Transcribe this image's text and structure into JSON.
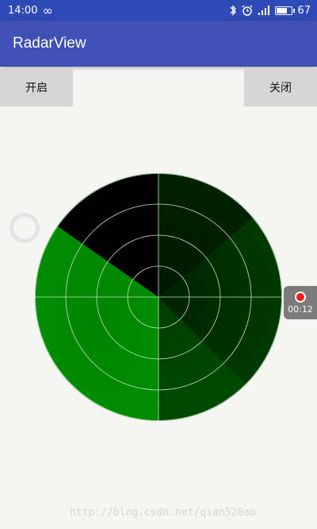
{
  "status_bar": {
    "time": "14:00",
    "infinity": "∞",
    "battery": "67",
    "battery_level": 0.67
  },
  "app_bar": {
    "title": "RadarView"
  },
  "buttons": {
    "open_label": "开启",
    "close_label": "关闭"
  },
  "radar": {
    "sweep_color": "#008a00",
    "dark_color": "#000000",
    "base_color": "#003300",
    "grid_color": "#bfe6bf",
    "ring_count": 4
  },
  "record": {
    "time": "00:12"
  },
  "watermark": "http://blog.csdn.net/qian520ao"
}
